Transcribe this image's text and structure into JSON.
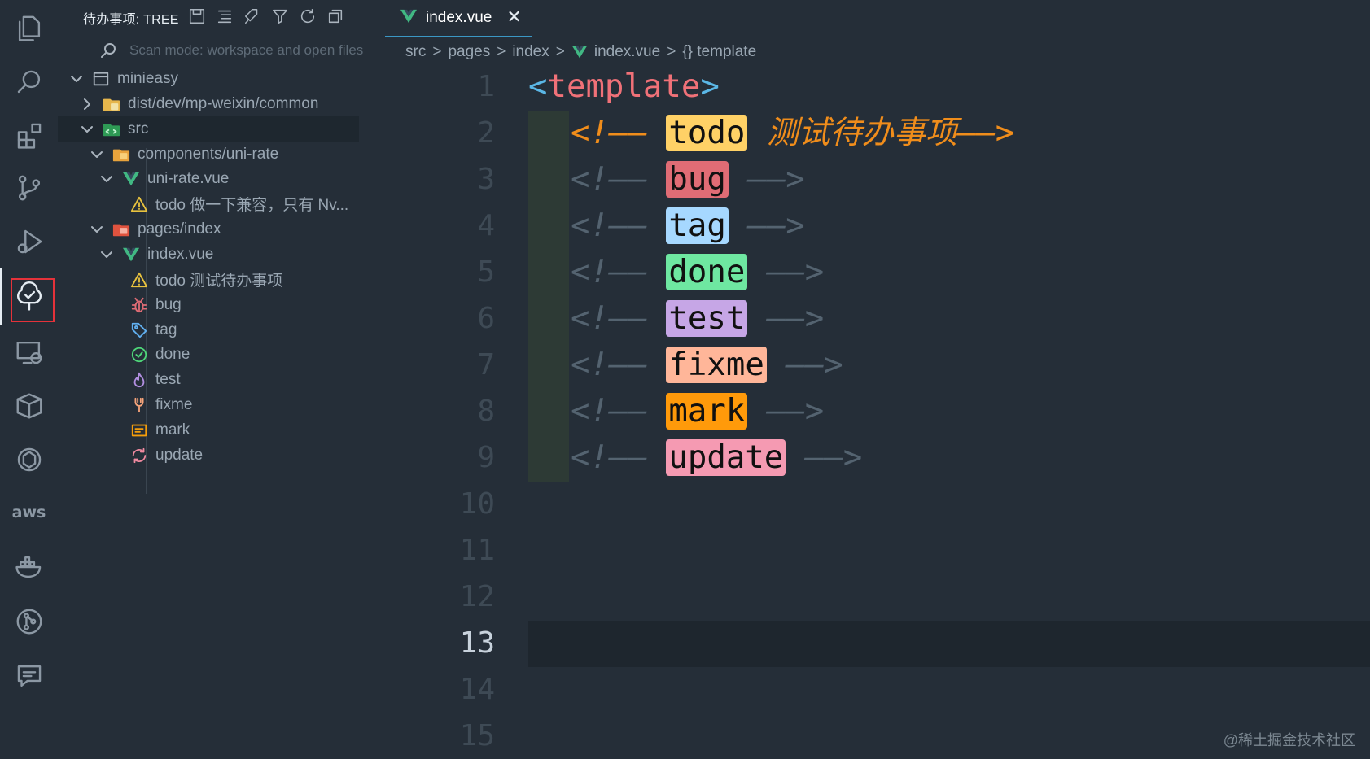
{
  "activity_bar": {
    "items": [
      {
        "name": "explorer-icon"
      },
      {
        "name": "search-icon"
      },
      {
        "name": "extensions-icon"
      },
      {
        "name": "source-control-icon"
      },
      {
        "name": "run-debug-icon"
      },
      {
        "name": "todo-tree-icon"
      },
      {
        "name": "remote-explorer-icon"
      },
      {
        "name": "package-icon"
      },
      {
        "name": "chatgpt-icon"
      },
      {
        "name": "aws-icon",
        "label": "aws"
      },
      {
        "name": "docker-icon"
      },
      {
        "name": "git-graph-icon"
      },
      {
        "name": "chat-icon"
      }
    ]
  },
  "sidebar": {
    "title": "待办事项: TREE",
    "scan_text": "Scan mode: workspace and open files",
    "tree": {
      "root": "minieasy",
      "dist": "dist/dev/mp-weixin/common",
      "src": "src",
      "components": "components/uni-rate",
      "uni_rate_file": "uni-rate.vue",
      "uni_rate_todo": "todo 做一下兼容，只有 Nv...",
      "pages": "pages/index",
      "index_file": "index.vue",
      "items": [
        {
          "label": "todo 测试待办事项",
          "icon": "warning-icon",
          "color": "#e8c23e"
        },
        {
          "label": "bug",
          "icon": "bug-icon",
          "color": "#e06c75"
        },
        {
          "label": "tag",
          "icon": "tag-icon",
          "color": "#61afef"
        },
        {
          "label": "done",
          "icon": "check-circle-icon",
          "color": "#4ed679"
        },
        {
          "label": "test",
          "icon": "flame-icon",
          "color": "#b18ee0"
        },
        {
          "label": "fixme",
          "icon": "wrench-icon",
          "color": "#f5a37a"
        },
        {
          "label": "mark",
          "icon": "note-icon",
          "color": "#f59e0b"
        },
        {
          "label": "update",
          "icon": "sync-icon",
          "color": "#f08aa0"
        }
      ]
    }
  },
  "tab": {
    "label": "index.vue",
    "close": "✕"
  },
  "breadcrumbs": {
    "parts": [
      "src",
      "pages",
      "index",
      "index.vue"
    ],
    "last": "{} template",
    "sep": ">"
  },
  "editor": {
    "line_numbers": [
      "1",
      "2",
      "3",
      "4",
      "5",
      "6",
      "7",
      "8",
      "9",
      "10",
      "11",
      "12",
      "13",
      "14",
      "15"
    ],
    "current_line": "13",
    "template_open": "<",
    "template_name": "template",
    "template_close": ">",
    "comment_open": "<!—— ",
    "comment_close": "——>",
    "lines": [
      {
        "kw": "todo",
        "bg": "#ffd166",
        "extra": "测试待办事项"
      },
      {
        "kw": "bug",
        "bg": "#e06c75",
        "extra": ""
      },
      {
        "kw": "tag",
        "bg": "#a6d8ff",
        "extra": ""
      },
      {
        "kw": "done",
        "bg": "#6ee7a1",
        "extra": ""
      },
      {
        "kw": "test",
        "bg": "#c6a6e6",
        "extra": ""
      },
      {
        "kw": "fixme",
        "bg": "#ffb699",
        "extra": ""
      },
      {
        "kw": "mark",
        "bg": "#ff9a0a",
        "extra": ""
      },
      {
        "kw": "update",
        "bg": "#f59ab2",
        "extra": ""
      }
    ]
  },
  "watermark": "@稀土掘金技术社区"
}
